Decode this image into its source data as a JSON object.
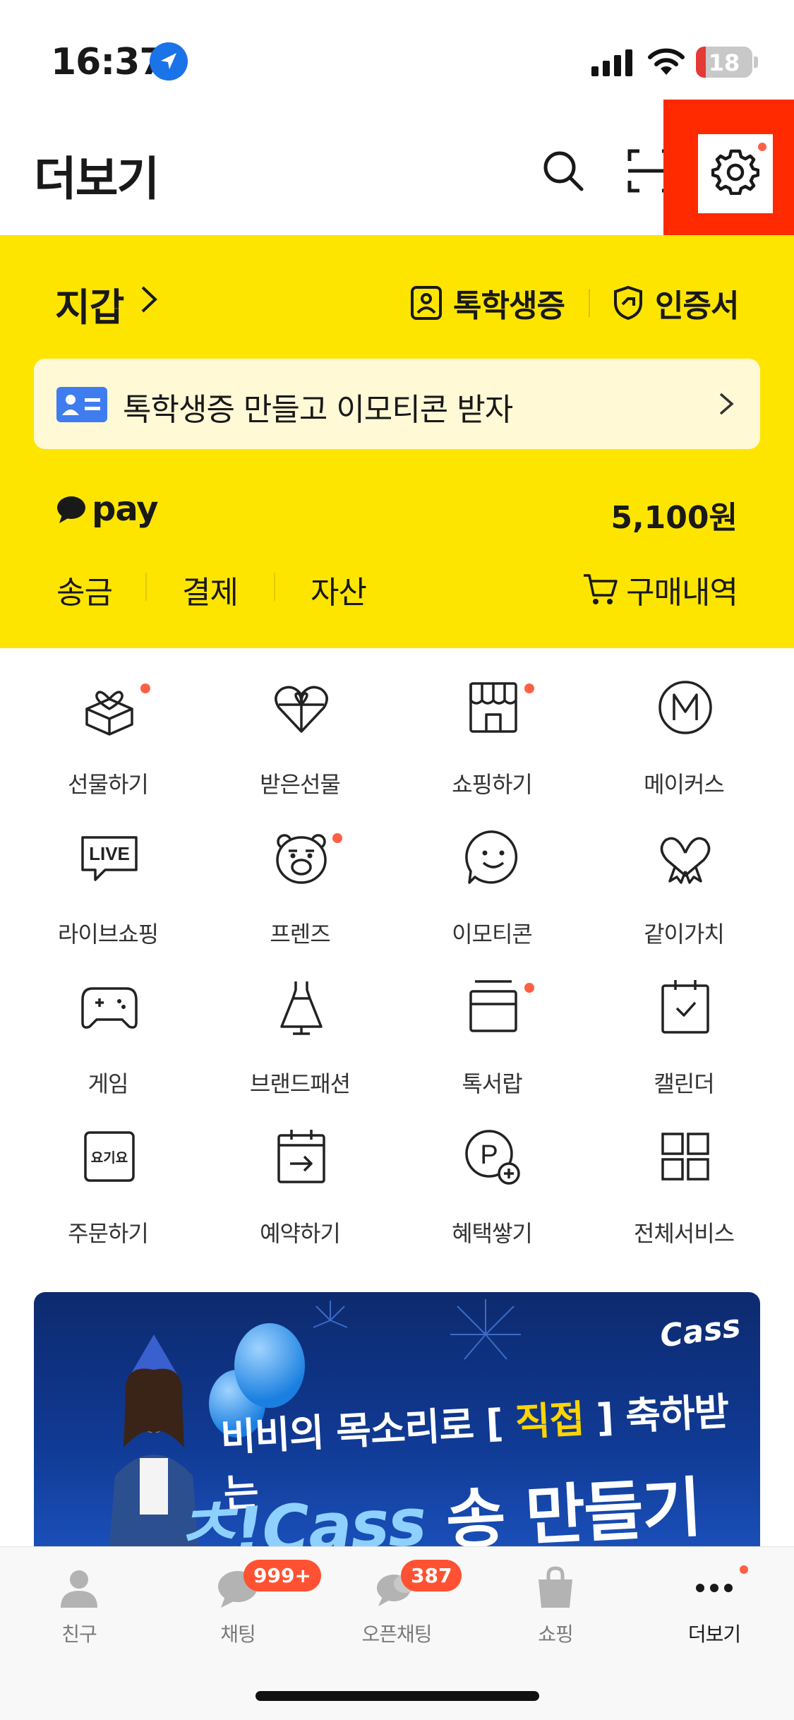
{
  "status_bar": {
    "time": "16:37",
    "battery": "18",
    "battery_level": 0.18
  },
  "header": {
    "title": "더보기"
  },
  "wallet": {
    "title": "지갑",
    "student_id_label": "톡학생증",
    "certificate_label": "인증서",
    "promo_text": "톡학생증 만들고 이모티콘 받자",
    "pay_label": "pay",
    "balance": "5,100원",
    "pay_menu": [
      "송금",
      "결제",
      "자산"
    ],
    "purchase_history": "구매내역"
  },
  "services": [
    {
      "label": "선물하기",
      "icon": "gift-icon",
      "dot": true
    },
    {
      "label": "받은선물",
      "icon": "heart-gift-icon",
      "dot": false
    },
    {
      "label": "쇼핑하기",
      "icon": "store-icon",
      "dot": true
    },
    {
      "label": "메이커스",
      "icon": "makers-icon",
      "dot": false
    },
    {
      "label": "라이브쇼핑",
      "icon": "live-icon",
      "dot": false
    },
    {
      "label": "프렌즈",
      "icon": "bear-icon",
      "dot": true
    },
    {
      "label": "이모티콘",
      "icon": "smile-icon",
      "dot": false
    },
    {
      "label": "같이가치",
      "icon": "heart-ribbon-icon",
      "dot": false
    },
    {
      "label": "게임",
      "icon": "gamepad-icon",
      "dot": false
    },
    {
      "label": "브랜드패션",
      "icon": "dress-icon",
      "dot": false
    },
    {
      "label": "톡서랍",
      "icon": "drawer-icon",
      "dot": true
    },
    {
      "label": "캘린더",
      "icon": "calendar-icon",
      "dot": false
    },
    {
      "label": "주문하기",
      "icon": "order-icon",
      "dot": false
    },
    {
      "label": "예약하기",
      "icon": "reserve-icon",
      "dot": false
    },
    {
      "label": "혜택쌓기",
      "icon": "point-icon",
      "dot": false
    },
    {
      "label": "전체서비스",
      "icon": "grid-icon",
      "dot": false
    }
  ],
  "order_icon_text": "요기요",
  "point_icon_text": "P",
  "live_icon_text": "LIVE",
  "banner": {
    "brand": "Cass",
    "line1_pre": "비비의 목소리로 [",
    "line1_highlight": "직접",
    "line1_post": "] 축하받는",
    "line2_brand": "츠!Cass",
    "line2_suffix": "송 만들기"
  },
  "tabbar": {
    "tabs": [
      {
        "label": "친구",
        "icon": "person-icon"
      },
      {
        "label": "채팅",
        "icon": "chat-icon",
        "badge": "999+"
      },
      {
        "label": "오픈채팅",
        "icon": "open-chat-icon",
        "badge": "387"
      },
      {
        "label": "쇼핑",
        "icon": "bag-icon"
      },
      {
        "label": "더보기",
        "icon": "more-icon",
        "active": true
      }
    ]
  },
  "colors": {
    "accent": "#fee500",
    "highlight": "#ff2a00",
    "badge": "#ff5232"
  }
}
